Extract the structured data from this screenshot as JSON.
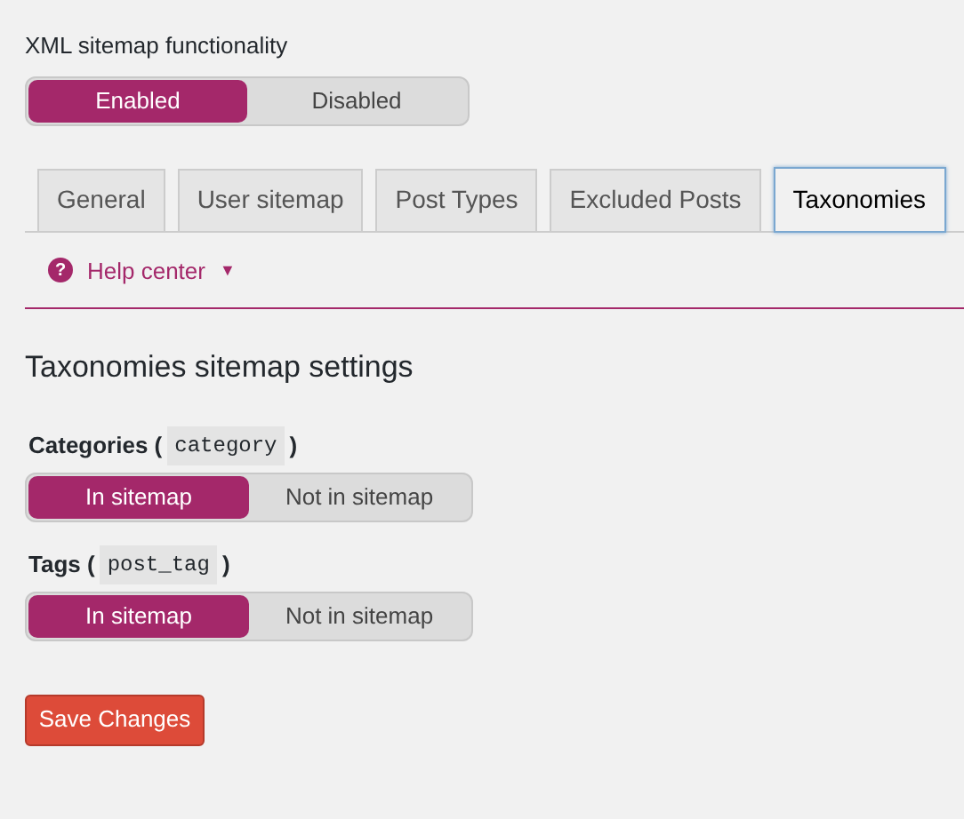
{
  "functionality": {
    "label": "XML sitemap functionality",
    "options": [
      {
        "label": "Enabled",
        "selected": true
      },
      {
        "label": "Disabled",
        "selected": false
      }
    ]
  },
  "tabs": [
    {
      "label": "General",
      "selected": false
    },
    {
      "label": "User sitemap",
      "selected": false
    },
    {
      "label": "Post Types",
      "selected": false
    },
    {
      "label": "Excluded Posts",
      "selected": false
    },
    {
      "label": "Taxonomies",
      "selected": true
    }
  ],
  "help": {
    "icon": "?",
    "label": "Help center",
    "caret": "▼"
  },
  "heading": "Taxonomies sitemap settings",
  "settings": [
    {
      "label_open": "Categories (",
      "code": "category",
      "label_close": ")",
      "options": [
        {
          "label": "In sitemap",
          "selected": true
        },
        {
          "label": "Not in sitemap",
          "selected": false
        }
      ]
    },
    {
      "label_open": "Tags (",
      "code": "post_tag",
      "label_close": ")",
      "options": [
        {
          "label": "In sitemap",
          "selected": true
        },
        {
          "label": "Not in sitemap",
          "selected": false
        }
      ]
    }
  ],
  "save_button": "Save Changes"
}
